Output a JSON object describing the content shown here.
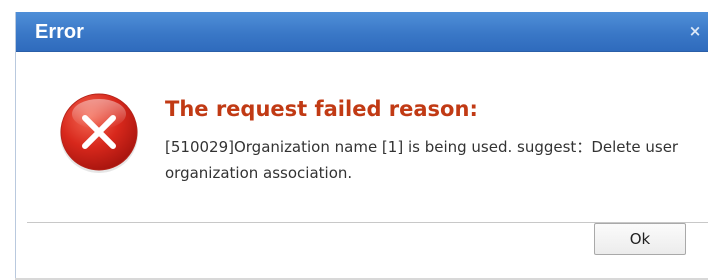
{
  "dialog": {
    "title": "Error",
    "close_glyph": "×",
    "icon": "error-x-circle-icon",
    "heading": "The request failed reason:",
    "message": "[510029]Organization name [1] is being used. suggest：Delete user organization association.",
    "ok_label": "Ok"
  },
  "colors": {
    "titlebar": "#3a78c7",
    "heading": "#c13a14",
    "icon_red": "#d8281c"
  }
}
